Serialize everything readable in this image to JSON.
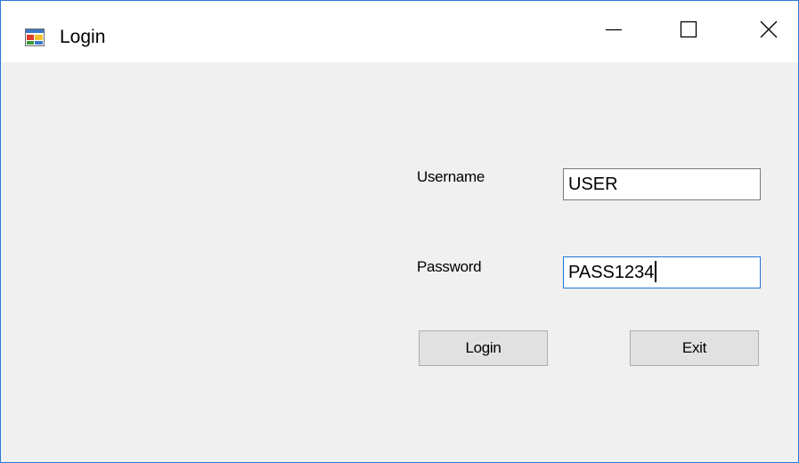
{
  "window": {
    "title": "Login",
    "accent_color": "#2b79d6",
    "icon": "app-window-icon",
    "controls": {
      "minimize": "minimize-icon",
      "maximize": "maximize-icon",
      "close": "close-icon"
    }
  },
  "form": {
    "username_label": "Username",
    "username_value": "USER",
    "password_label": "Password",
    "password_value": "PASS1234",
    "login_button": "Login",
    "exit_button": "Exit"
  }
}
